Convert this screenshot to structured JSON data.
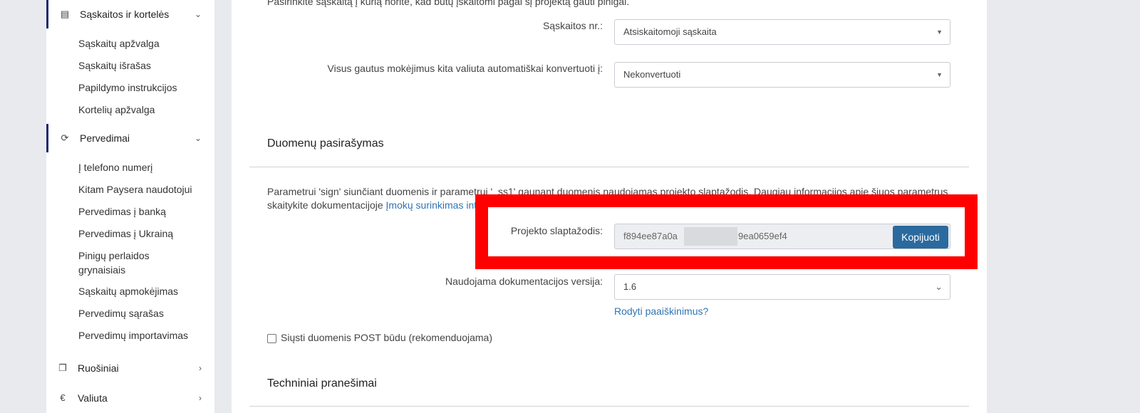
{
  "sidebar": {
    "sections": [
      {
        "label": "Sąskaitos ir kortelės",
        "icon": "cards-icon"
      },
      {
        "label": "Pervedimai",
        "icon": "transfer-icon"
      },
      {
        "label": "Ruošiniai",
        "icon": "copy-icon"
      },
      {
        "label": "Valiuta",
        "icon": "euro-icon"
      }
    ],
    "accounts_items": [
      "Sąskaitų apžvalga",
      "Sąskaitų išrašas",
      "Papildymo instrukcijos",
      "Kortelių apžvalga"
    ],
    "transfer_items": [
      "Į telefono numerį",
      "Kitam Paysera naudotojui",
      "Pervedimas į banką",
      "Pervedimas į Ukrainą",
      "Pinigų perlaidos grynaisiais",
      "Sąskaitų apmokėjimas",
      "Pervedimų sąrašas",
      "Pervedimų importavimas"
    ]
  },
  "main": {
    "intro_text": "Pasirinkite sąskaitą į kurią norite, kad būtų įskaitomi pagal šį projektą gauti pinigai.",
    "account_label": "Sąskaitos nr.:",
    "account_value": "Atsiskaitomoji sąskaita",
    "convert_label": "Visus gautus mokėjimus kita valiuta automatiškai konvertuoti į:",
    "convert_value": "Nekonvertuoti",
    "signing_title": "Duomenų pasirašymas",
    "signing_text_1": "Parametrui 'sign' siunčiant duomenis ir parametrui '_ss1' gaunant duomenis naudojamas projekto slaptažodis. Daugiau informacijos apie šiuos parametrus",
    "signing_text_2": "skaitykite dokumentacijoje ",
    "signing_link": "Įmokų surinkimas int",
    "password_label": "Projekto slaptažodis:",
    "password_start": "f894ee87a0a",
    "password_end": "9ea0659ef4",
    "copy_button": "Kopijuoti",
    "doc_version_label": "Naudojama dokumentacijos versija:",
    "doc_version_value": "1.6",
    "show_explanations": "Rodyti paaiškinimus?",
    "post_checkbox_label": "Siųsti duomenis POST būdu (rekomenduojama)",
    "tech_title": "Techniniai pranešimai"
  }
}
